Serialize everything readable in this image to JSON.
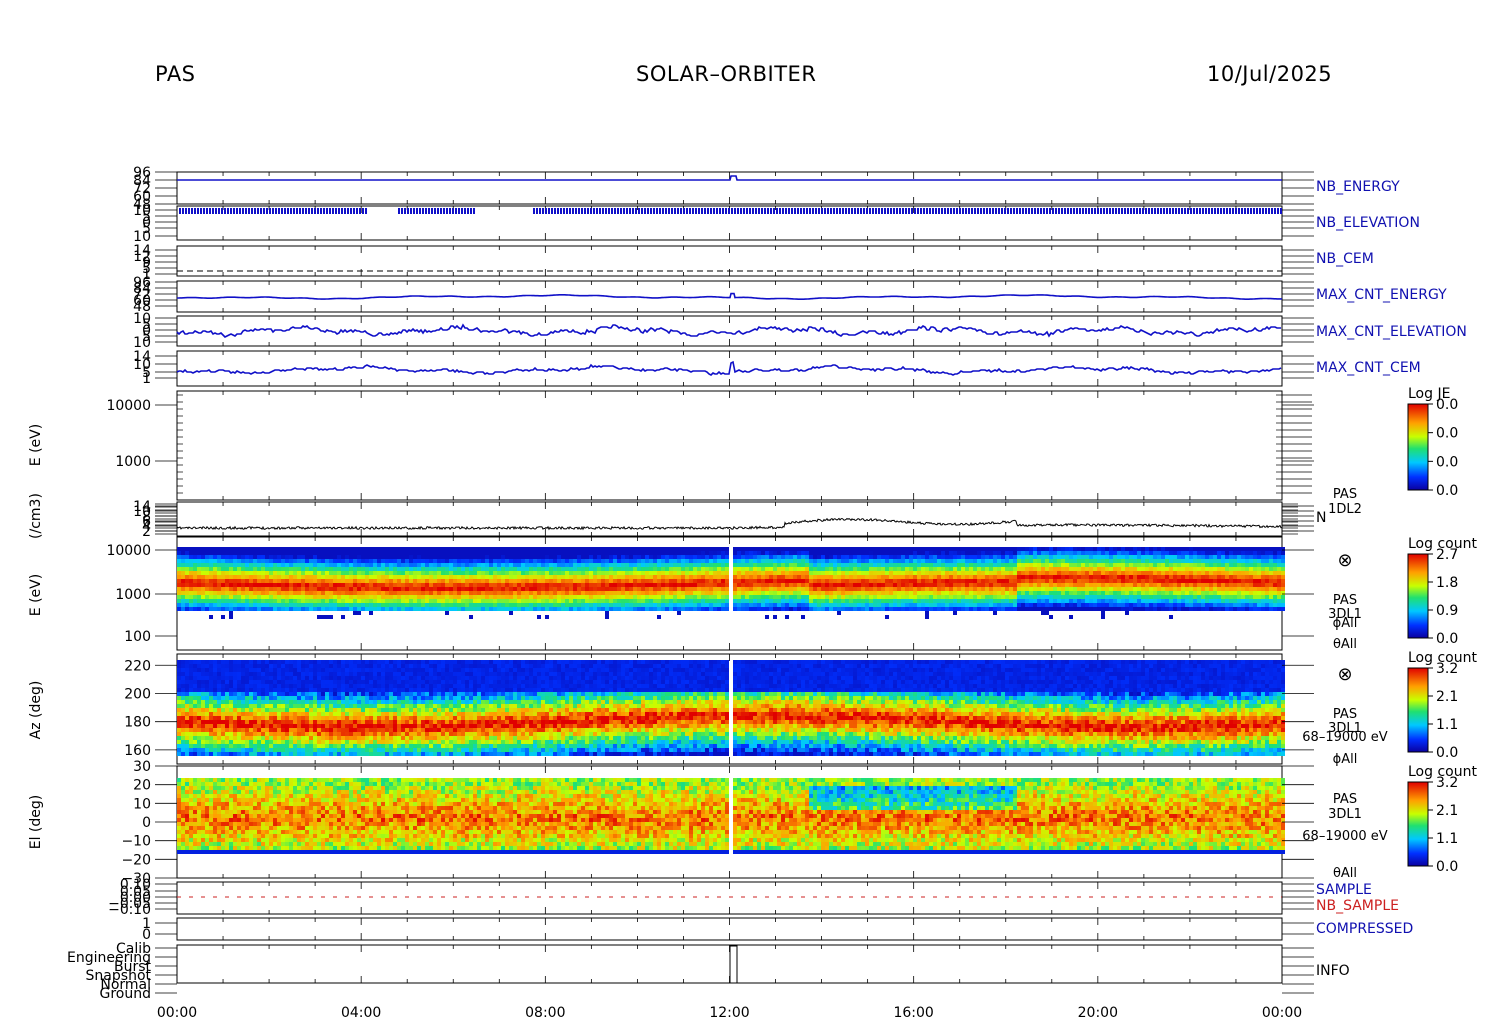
{
  "header": {
    "instrument": "PAS",
    "mission": "SOLAR–ORBITER",
    "date": "10/Jul/2025"
  },
  "colors": {
    "trace_blue": "#1010c8",
    "label_blue": "#1010b0",
    "label_red": "#cc2020",
    "axis": "#000000"
  },
  "chart_data": [
    {
      "type": "line",
      "panel": "NB_ENERGY",
      "label": "NB_ENERGY",
      "label_color": "#1010b0",
      "tick_labels": [
        "96",
        "84",
        "72",
        "60",
        "48"
      ]
    },
    {
      "type": "line",
      "panel": "NB_ELEVATION",
      "label": "NB_ELEVATION",
      "label_color": "#1010b0",
      "tick_labels": [
        "10",
        "5",
        "0",
        "5",
        "10"
      ]
    },
    {
      "type": "line",
      "panel": "NB_CEM",
      "label": "NB_CEM",
      "label_color": "#1010b0",
      "tick_labels": [
        "14",
        "12",
        "9",
        "5",
        "1"
      ]
    },
    {
      "type": "line",
      "panel": "MAX_CNT_ENERGY",
      "label": "MAX_CNT_ENERGY",
      "label_color": "#1010b0",
      "tick_labels": [
        "96",
        "84",
        "72",
        "60",
        "48"
      ]
    },
    {
      "type": "line",
      "panel": "MAX_CNT_ELEVATION",
      "label": "MAX_CNT_ELEVATION",
      "label_color": "#1010b0",
      "tick_labels": [
        "10",
        "5",
        "0",
        "5",
        "10"
      ]
    },
    {
      "type": "line",
      "panel": "MAX_CNT_CEM",
      "label": "MAX_CNT_CEM",
      "label_color": "#1010b0",
      "tick_labels": [
        "14",
        "10",
        "5",
        "1"
      ]
    },
    {
      "type": "heatmap",
      "panel": "E_JE",
      "ylabel": "E (eV)",
      "y_scale": "log",
      "tick_labels": [
        "10000",
        "1000"
      ],
      "colorbar": {
        "title": "Log JE",
        "ticks": [
          "0.0",
          "0.0",
          "0.0",
          "0.0"
        ]
      }
    },
    {
      "type": "line",
      "panel": "N",
      "ylabel": "(/cm3)",
      "label": "N",
      "tick_labels": [
        "14",
        "10",
        "8",
        "6",
        "4",
        "2"
      ],
      "side_text": [
        "PAS",
        "1DL2"
      ]
    },
    {
      "type": "heatmap",
      "panel": "E_count",
      "ylabel": "E (eV)",
      "y_scale": "log",
      "tick_labels": [
        "10000",
        "1000",
        "100"
      ],
      "side_text": [
        "PAS",
        "3DL1",
        "ϕAll",
        "θAll"
      ],
      "colorbar": {
        "title": "Log count",
        "ticks": [
          "2.7",
          "1.8",
          "0.9",
          "0.0"
        ]
      }
    },
    {
      "type": "heatmap",
      "panel": "Az",
      "ylabel": "Az (deg)",
      "ylim": [
        150,
        228
      ],
      "tick_values": [
        220,
        200,
        180,
        160
      ],
      "tick_labels": [
        "220",
        "200",
        "180",
        "160"
      ],
      "side_text": [
        "PAS",
        "3DL1",
        "68–19000 eV",
        "ϕAll"
      ],
      "colorbar": {
        "title": "Log count",
        "ticks": [
          "3.2",
          "2.1",
          "1.1",
          "0.0"
        ]
      }
    },
    {
      "type": "heatmap",
      "panel": "El",
      "ylabel": "El (deg)",
      "ylim": [
        -30,
        30
      ],
      "tick_values": [
        30,
        20,
        10,
        0,
        -10,
        -20,
        -30
      ],
      "tick_labels": [
        "30",
        "20",
        "10",
        "0",
        "−10",
        "−20",
        "−30"
      ],
      "side_text": [
        "PAS",
        "3DL1",
        "68–19000 eV",
        "θAll"
      ],
      "colorbar": {
        "title": "Log count",
        "ticks": [
          "3.2",
          "2.1",
          "1.1",
          "0.0"
        ]
      }
    },
    {
      "type": "line",
      "panel": "SAMPLE",
      "labels": [
        "SAMPLE",
        "NB_SAMPLE"
      ],
      "label_colors": [
        "#1010b0",
        "#cc2020"
      ],
      "tick_labels": [
        "0.10",
        "0.05",
        "0.00",
        "−0.05",
        "−0.10"
      ]
    },
    {
      "type": "line",
      "panel": "COMPRESSED",
      "label": "COMPRESSED",
      "label_color": "#1010b0",
      "tick_labels": [
        "1",
        "0"
      ]
    },
    {
      "type": "line",
      "panel": "INFO",
      "label": "INFO",
      "categories": [
        "Calib",
        "Engineering",
        "Burst",
        "Snapshot",
        "Normal",
        "Ground"
      ]
    }
  ],
  "time_axis": {
    "xlim_hours": [
      0,
      24
    ],
    "tick_hours": [
      0,
      4,
      8,
      12,
      16,
      20,
      24
    ],
    "tick_labels": [
      "00:00",
      "04:00",
      "08:00",
      "12:00",
      "16:00",
      "20:00",
      "00:00"
    ]
  }
}
